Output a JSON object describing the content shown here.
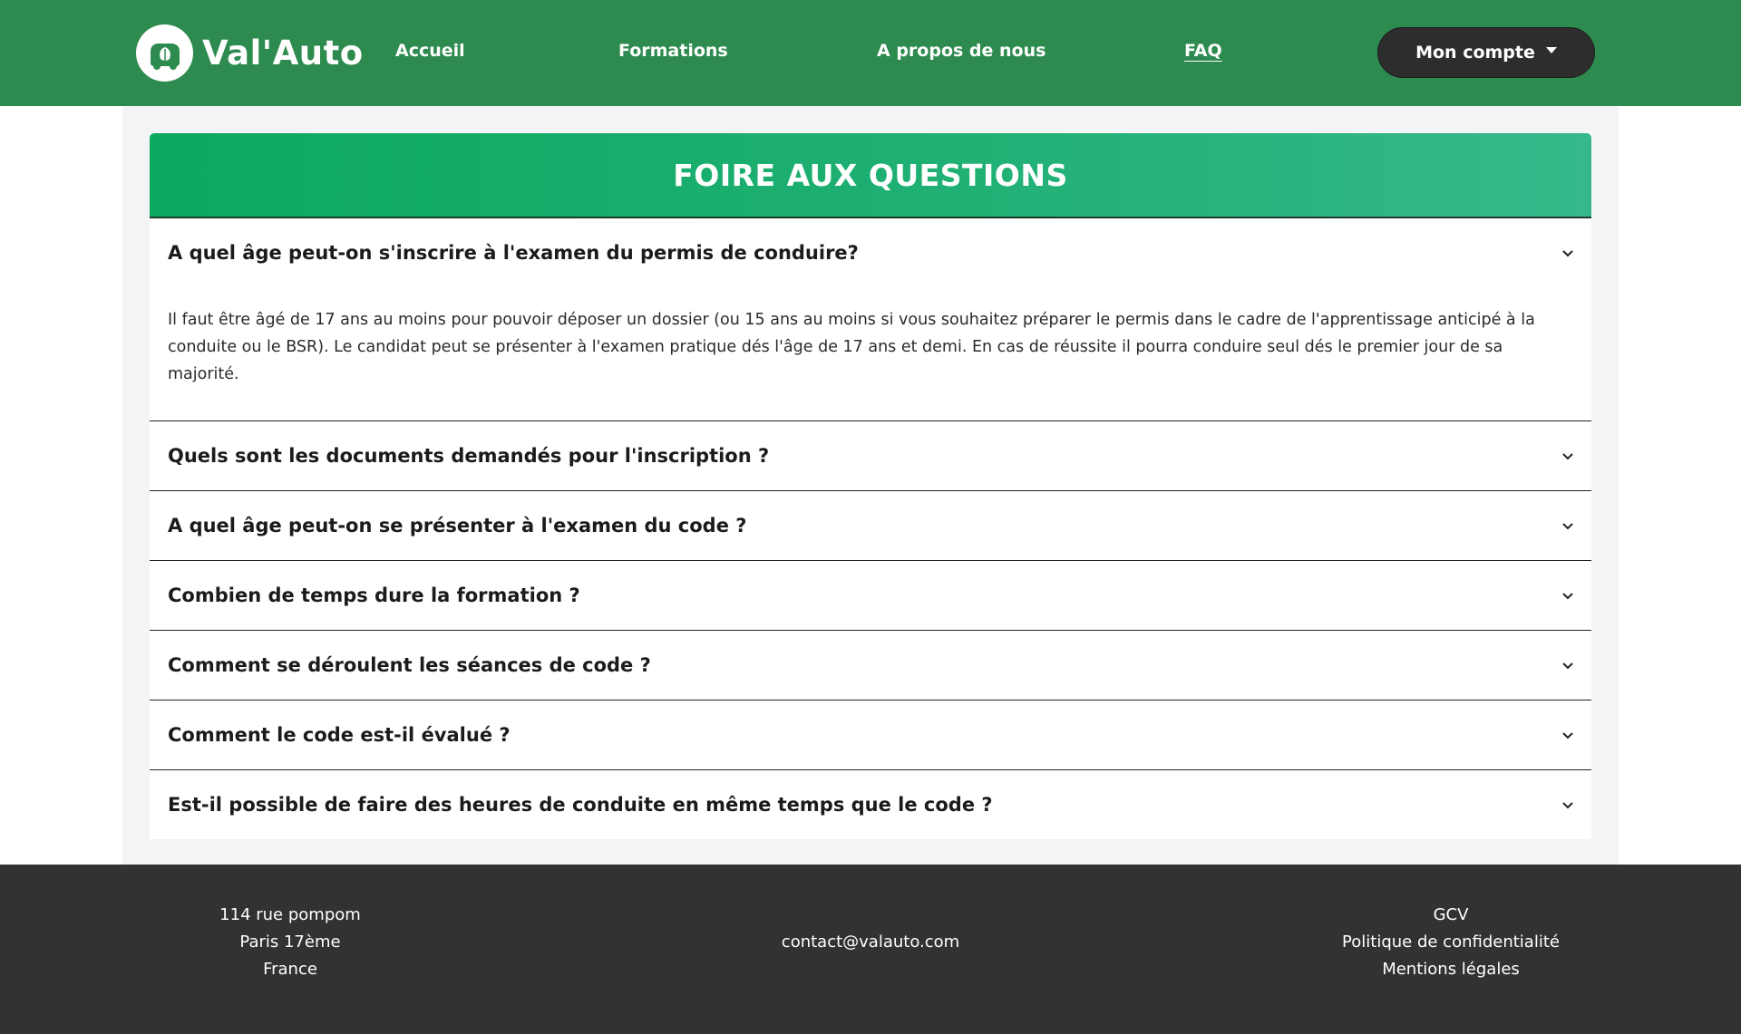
{
  "brand": {
    "name": "Val'Auto"
  },
  "nav": {
    "accueil": "Accueil",
    "formations": "Formations",
    "apropos": "A propos de nous",
    "faq": "FAQ",
    "account": "Mon compte"
  },
  "faq": {
    "title": "FOIRE AUX QUESTIONS",
    "items": [
      {
        "question": "A quel âge peut-on s'inscrire à l'examen du permis de conduire?",
        "answer": "Il faut être âgé de 17 ans au moins pour pouvoir déposer un dossier (ou 15 ans au moins si vous souhaitez préparer le permis dans le cadre de l'apprentissage anticipé à la conduite ou le BSR). Le candidat peut se présenter à l'examen pratique dés l'âge de 17 ans et demi. En cas de réussite il pourra conduire seul dés le premier jour de sa majorité."
      },
      {
        "question": "Quels sont les documents demandés pour l'inscription ?"
      },
      {
        "question": "A quel âge peut-on se présenter à l'examen du code ?"
      },
      {
        "question": "Combien de temps dure la formation ?"
      },
      {
        "question": "Comment se déroulent les séances de code ?"
      },
      {
        "question": "Comment le code est-il évalué ?"
      },
      {
        "question": "Est-il possible de faire des heures de conduite en même temps que le code ?"
      }
    ]
  },
  "footer": {
    "address": [
      "114 rue pompom",
      "Paris 17ème",
      "France"
    ],
    "email": "contact@valauto.com",
    "links": [
      "GCV",
      "Politique de confidentialité",
      "Mentions légales"
    ]
  },
  "colors": {
    "navbar": "#2e8b4f",
    "header_gradient_start": "#0da862",
    "header_gradient_end": "#36b88a",
    "footer": "#323232",
    "account_button": "#2d2d2d"
  }
}
